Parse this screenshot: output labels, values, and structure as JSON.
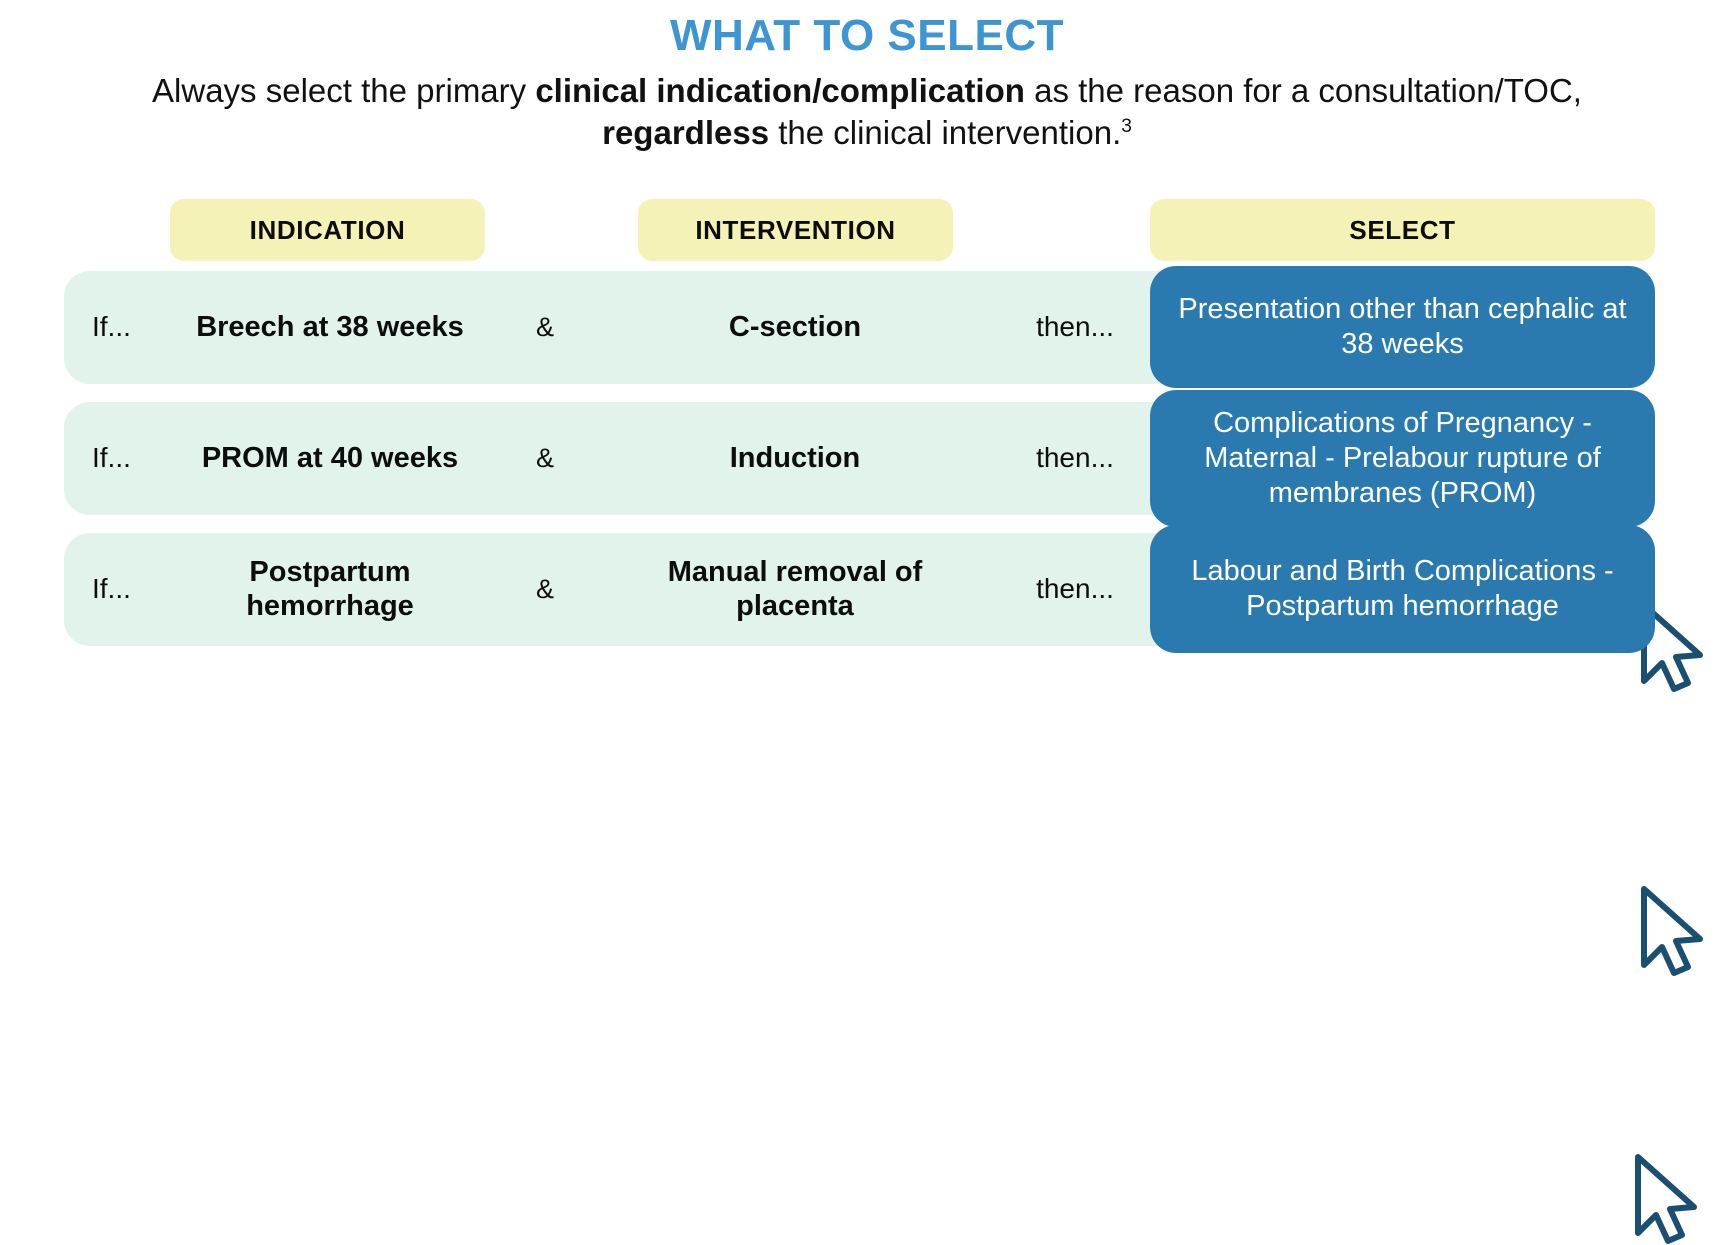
{
  "header": {
    "title": "WHAT TO SELECT",
    "subtitle_parts": [
      {
        "text": "Always select the primary ",
        "bold": false
      },
      {
        "text": "clinical indication/complication",
        "bold": true
      },
      {
        "text": " as the reason for a consultation/TOC, ",
        "bold": false
      },
      {
        "text": "regardless",
        "bold": true
      },
      {
        "text": " the clinical intervention.",
        "bold": false
      }
    ],
    "subtitle_footnote": "3",
    "subtitle_plain": "Always select the primary clinical indication/complication as the reason for a consultation/TOC, regardless the clinical intervention.3"
  },
  "columns": {
    "indication": "INDICATION",
    "intervention": "INTERVENTION",
    "select": "SELECT"
  },
  "connectors": {
    "if": "If...",
    "and": "&",
    "then": "then..."
  },
  "rows": [
    {
      "if": "If...",
      "indication": "Breech at 38 weeks",
      "and": "&",
      "intervention": "C-section",
      "then": "then...",
      "select": "Presentation other than cephalic at 38 weeks",
      "cursor": "mouse-pointer-icon"
    },
    {
      "if": "If...",
      "indication": "PROM at 40 weeks",
      "and": "&",
      "intervention": "Induction",
      "then": "then...",
      "select": "Complications of Pregnancy - Maternal - Prelabour rupture of membranes (PROM)",
      "cursor": "mouse-pointer-icon"
    },
    {
      "if": "If...",
      "indication": "Postpartum hemorrhage",
      "and": "&",
      "intervention": "Manual removal of placenta",
      "then": "then...",
      "select": "Labour and Birth Complications - Postpartum hemorrhage",
      "cursor": "mouse-pointer-icon"
    }
  ],
  "colors": {
    "title_blue": "#3d96d2",
    "header_pill_yellow": "#f5f2b8",
    "row_mint": "#e2f3ec",
    "select_blue": "#2a7ab0",
    "cursor_outline": "#1b4f72",
    "text_black": "#0d0d0d",
    "background": "#ffffff"
  }
}
